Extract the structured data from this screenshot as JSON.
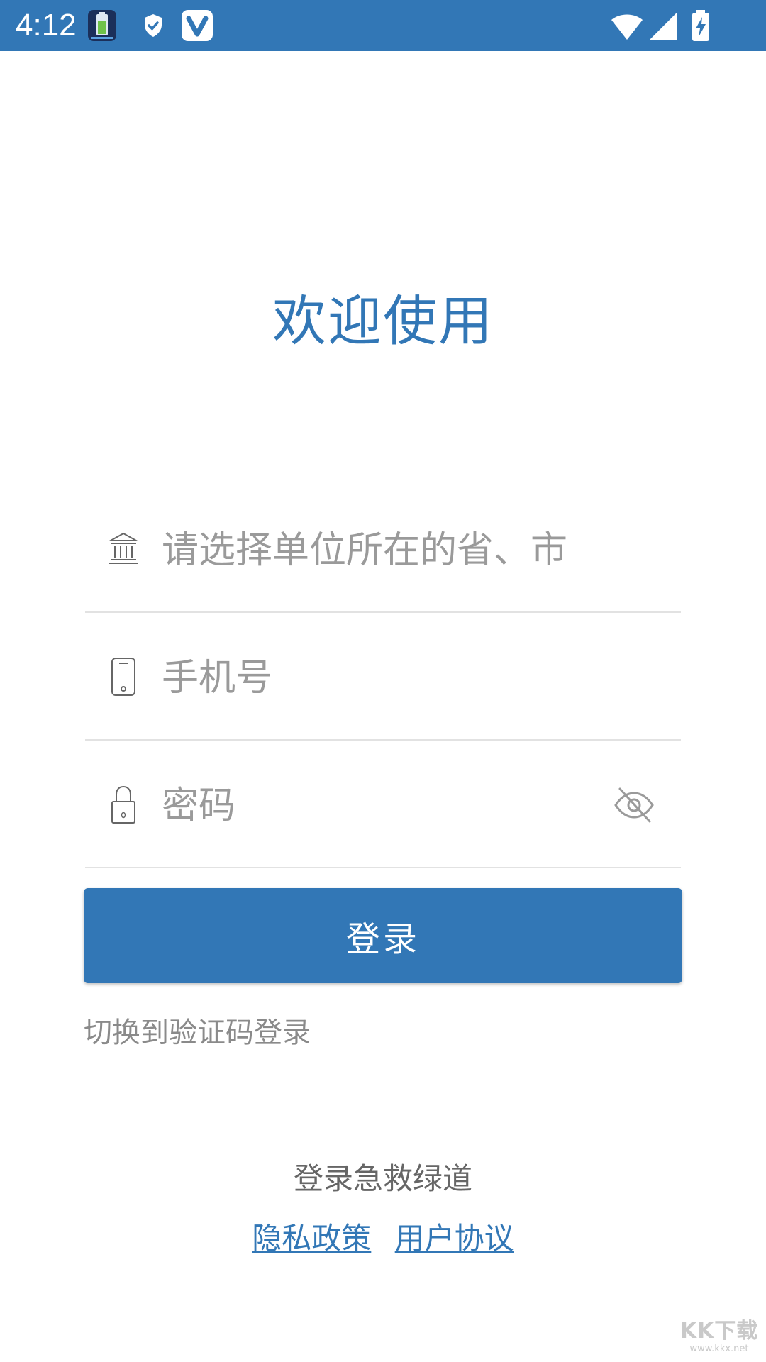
{
  "status_bar": {
    "time": "4:12",
    "left_icons": [
      "battery-app-icon",
      "shield-icon",
      "v-app-icon"
    ],
    "right_icons": [
      "wifi-icon",
      "signal-icon",
      "battery-charging-icon"
    ],
    "color": "#3277b6"
  },
  "welcome": {
    "title": "欢迎使用"
  },
  "form": {
    "region": {
      "placeholder": "请选择单位所在的省、市",
      "icon": "bank-icon"
    },
    "phone": {
      "placeholder": "手机号",
      "icon": "phone-icon"
    },
    "password": {
      "placeholder": "密码",
      "icon": "lock-icon",
      "toggle_icon": "eye-off-icon"
    },
    "login_label": "登录",
    "switch_label": "切换到验证码登录"
  },
  "footer": {
    "title": "登录急救绿道",
    "privacy_label": "隐私政策",
    "agreement_label": "用户协议"
  },
  "watermark": {
    "logo": "KK下载",
    "url": "www.kkx.net"
  },
  "colors": {
    "primary": "#3277b6",
    "placeholder": "#9a9a9a",
    "divider": "#e2e2e2"
  }
}
